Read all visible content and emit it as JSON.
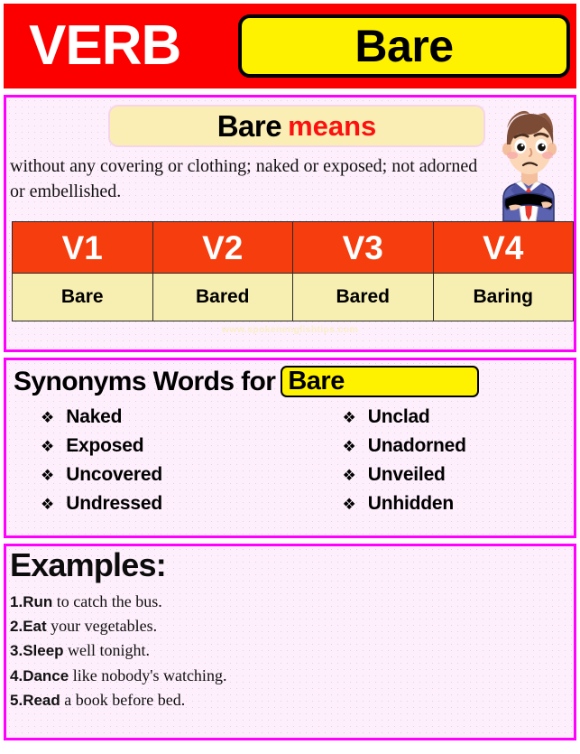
{
  "header": {
    "category_label": "VERB",
    "word": "Bare"
  },
  "meaning": {
    "chip_word": "Bare",
    "chip_means": "means",
    "definition": "without any covering or clothing; naked or exposed; not adorned or embellished.",
    "illustration": "confused-man-icon"
  },
  "verb_table": {
    "headers": [
      "V1",
      "V2",
      "V3",
      "V4"
    ],
    "values": [
      "Bare",
      "Bared",
      "Bared",
      "Baring"
    ]
  },
  "watermark": "www.spokenenglishtips.com",
  "synonyms": {
    "heading": "Synonyms Words for",
    "chip_word": "Bare",
    "bullet_glyph": "❖",
    "left_column": [
      "Naked",
      "Exposed",
      "Uncovered",
      "Undressed"
    ],
    "right_column": [
      "Unclad",
      "Unadorned",
      "Unveiled",
      "Unhidden"
    ]
  },
  "examples": {
    "title": "Examples:",
    "items": [
      {
        "number": "1.",
        "verb": "Run",
        "rest": " to catch the bus."
      },
      {
        "number": "2.",
        "verb": "Eat",
        "rest": " your vegetables."
      },
      {
        "number": "3.",
        "verb": "Sleep",
        "rest": " well tonight."
      },
      {
        "number": "4.",
        "verb": "Dance",
        "rest": " like nobody's watching."
      },
      {
        "number": "5.",
        "verb": "Read",
        "rest": " a book before bed."
      }
    ]
  },
  "colors": {
    "header_red": "#fc0000",
    "chip_yellow": "#fff200",
    "panel_border_magenta": "#ff00ff",
    "panel_bg_pink": "#fdeffb",
    "table_header_orange": "#f53d0e",
    "table_body_yellow": "#f7eeb2",
    "means_red": "#fc1010"
  }
}
